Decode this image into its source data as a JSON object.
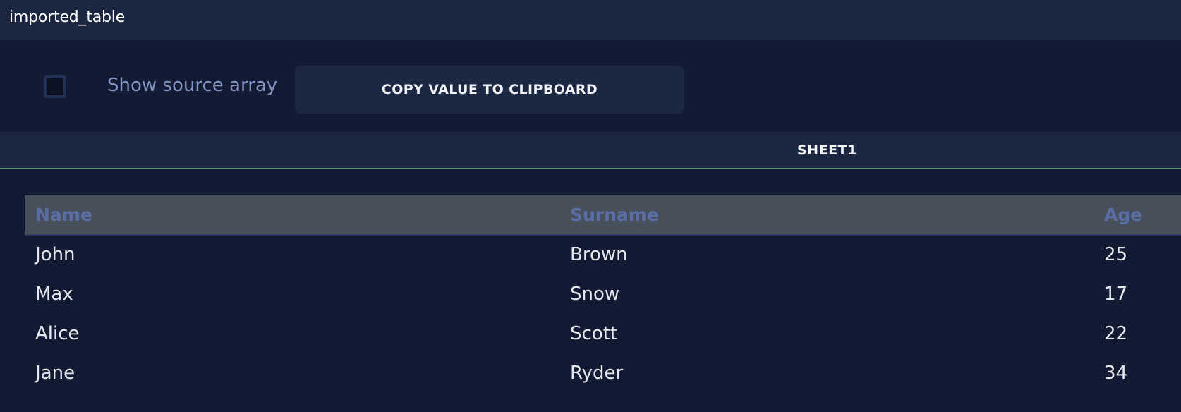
{
  "window": {
    "title": "imported_table"
  },
  "controls": {
    "show_source_label": "Show source array",
    "show_source_checked": false,
    "copy_button_label": "COPY VALUE TO CLIPBOARD"
  },
  "tabs": [
    {
      "label": "SHEET1",
      "active": true
    }
  ],
  "table": {
    "columns": [
      "Name",
      "Surname",
      "Age"
    ],
    "rows": [
      [
        "John",
        "Brown",
        "25"
      ],
      [
        "Max",
        "Snow",
        "17"
      ],
      [
        "Alice",
        "Scott",
        "22"
      ],
      [
        "Jane",
        "Ryder",
        "34"
      ]
    ]
  },
  "colors": {
    "accent_tab_underline": "#5a9e5a",
    "header_text": "#5a6ea6",
    "background": "#131a33"
  }
}
